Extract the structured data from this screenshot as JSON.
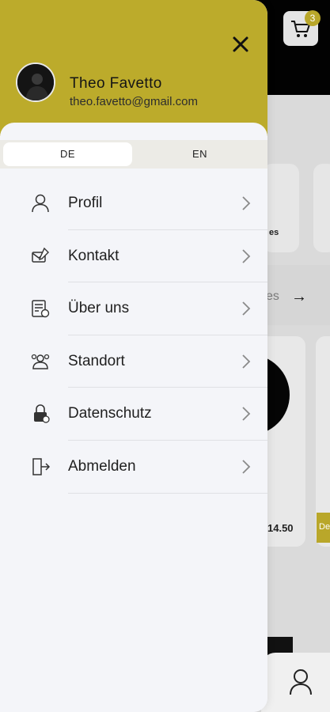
{
  "background": {
    "cart_count": "3",
    "card_label": "es",
    "see_all_text": "es",
    "arrow_glyph": "→",
    "price_fragment": "14.50",
    "tag_fragment": "De"
  },
  "drawer": {
    "user": {
      "name": "Theo Favetto",
      "email": "theo.favetto@gmail.com"
    },
    "language": {
      "options": [
        "DE",
        "EN"
      ],
      "selected": "DE"
    },
    "menu": [
      {
        "label": "Profil",
        "icon": "person-icon"
      },
      {
        "label": "Kontakt",
        "icon": "contact-icon"
      },
      {
        "label": "Über uns",
        "icon": "about-icon"
      },
      {
        "label": "Standort",
        "icon": "location-icon"
      },
      {
        "label": "Datenschutz",
        "icon": "privacy-icon"
      },
      {
        "label": "Abmelden",
        "icon": "logout-icon"
      }
    ]
  },
  "colors": {
    "accent": "#bcab2b",
    "drawer_bg": "#f4f5f9"
  }
}
